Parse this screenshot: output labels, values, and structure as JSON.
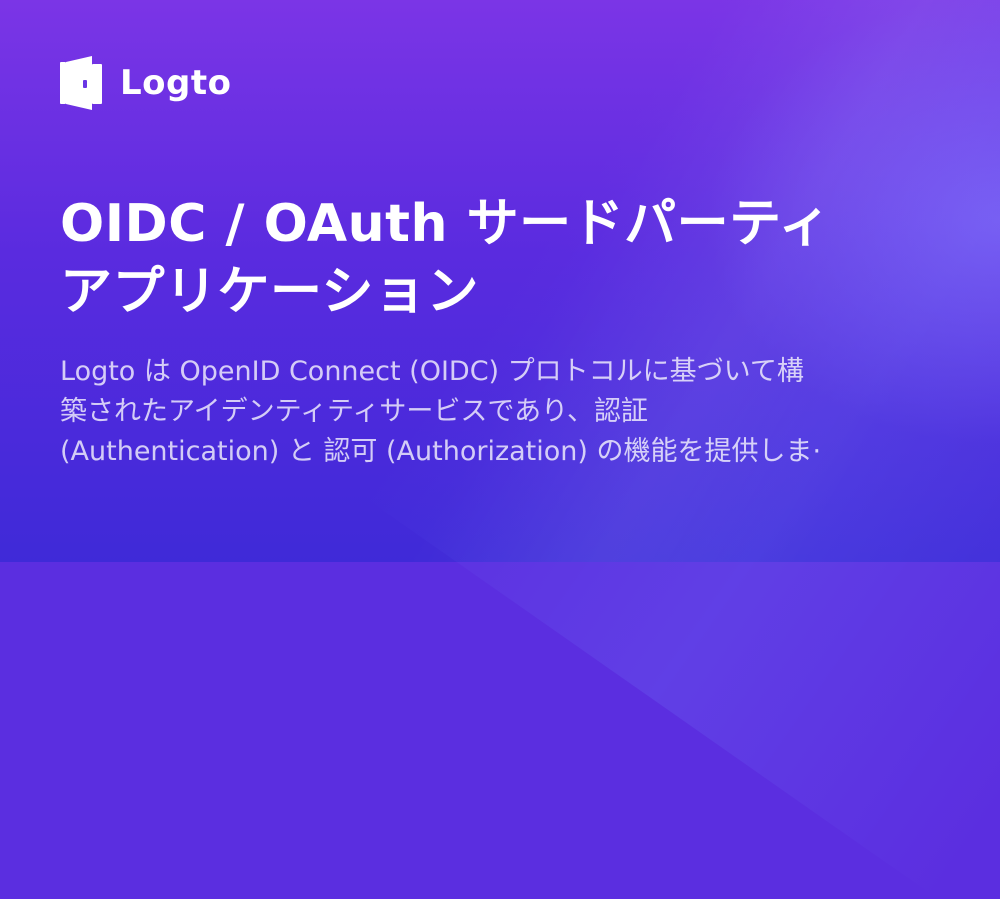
{
  "brand": {
    "logo_icon": "logto-door-icon",
    "name": "Logto"
  },
  "title": "OIDC / OAuth サードパーティ\nアプリケーション",
  "description": "Logto は OpenID Connect (OIDC) プロトコルに基づいて構\n築されたアイデンティティサービスであり、認証\n(Authentication) と 認可 (Authorization) の機能を提供しま·",
  "colors": {
    "background_top": "#7b35e6",
    "background_bottom": "#3f2ad8",
    "text": "#ffffff"
  }
}
